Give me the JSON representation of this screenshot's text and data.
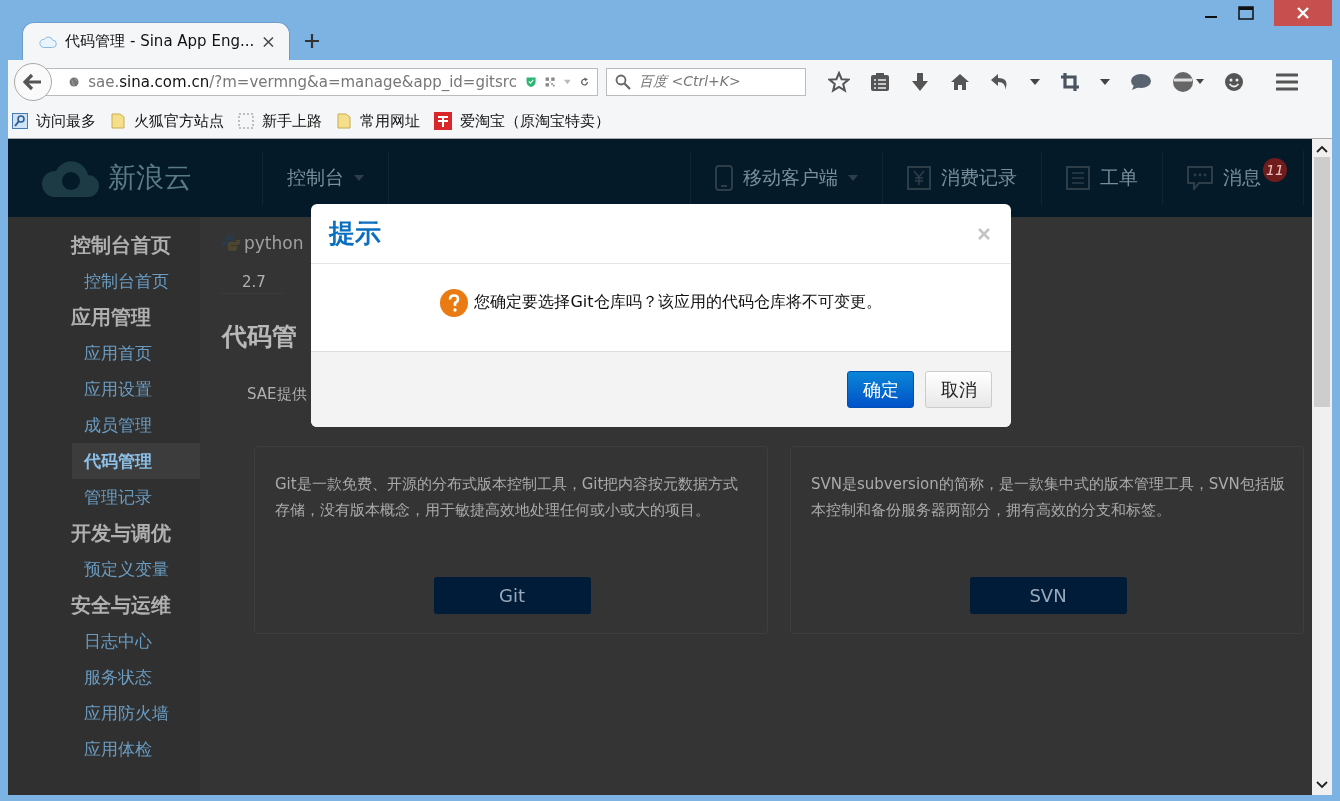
{
  "browser": {
    "tabs": [
      {
        "title": "代码管理 - Sina App Eng...",
        "selected": true
      }
    ],
    "url": {
      "prefix": "sae.",
      "domain": "sina.com.cn",
      "path": "/?m=vermng&a=manage&app_id=gitsrc"
    },
    "search": {
      "placeholder": "百度 <Ctrl+K>"
    },
    "bookmarks": [
      {
        "label": "访问最多",
        "kind": "smart"
      },
      {
        "label": "火狐官方站点",
        "kind": "folder"
      },
      {
        "label": "新手上路",
        "kind": "page"
      },
      {
        "label": "常用网址",
        "kind": "folder"
      },
      {
        "label": "爱淘宝（原淘宝特卖）",
        "kind": "taobao"
      }
    ]
  },
  "site_header": {
    "logo": "新浪云",
    "nav": [
      {
        "label": "控制台",
        "kind": "dropdown"
      },
      {
        "label": "移动客户端",
        "kind": "mobile"
      },
      {
        "label": "消费记录",
        "kind": "billing"
      },
      {
        "label": "工单",
        "kind": "ticket"
      },
      {
        "label": "消息",
        "kind": "message",
        "badge": "11"
      }
    ]
  },
  "sidebar": [
    {
      "title": "控制台首页",
      "items": [
        {
          "label": "控制台首页",
          "selected": false
        }
      ]
    },
    {
      "title": "应用管理",
      "items": [
        {
          "label": "应用首页",
          "selected": false
        },
        {
          "label": "应用设置",
          "selected": false
        },
        {
          "label": "成员管理",
          "selected": false
        },
        {
          "label": "代码管理",
          "selected": true
        },
        {
          "label": "管理记录",
          "selected": false
        }
      ]
    },
    {
      "title": "开发与调优",
      "items": [
        {
          "label": "预定义变量",
          "selected": false
        }
      ]
    },
    {
      "title": "安全与运维",
      "items": [
        {
          "label": "日志中心",
          "selected": false
        },
        {
          "label": "服务状态",
          "selected": false
        },
        {
          "label": "应用防火墙",
          "selected": false
        },
        {
          "label": "应用体检",
          "selected": false
        }
      ]
    }
  ],
  "content": {
    "runtime": {
      "logo": "python",
      "version": "2.7"
    },
    "heading": "代码管",
    "intro": "SAE提供",
    "cards": [
      {
        "description": "Git是一款免费、开源的分布式版本控制工具，Git把内容按元数据方式存储，没有版本概念，用于敏捷高效地处理任何或小或大的项目。",
        "button": "Git"
      },
      {
        "description": "SVN是subversion的简称，是一款集中式的版本管理工具，SVN包括版本控制和备份服务器两部分，拥有高效的分支和标签。",
        "button": "SVN"
      }
    ]
  },
  "dialog": {
    "title": "提示",
    "message": "您确定要选择Git仓库吗？该应用的代码仓库将不可变更。",
    "buttons": [
      {
        "label": "确定",
        "kind": "primary"
      },
      {
        "label": "取消",
        "kind": "default"
      }
    ]
  }
}
